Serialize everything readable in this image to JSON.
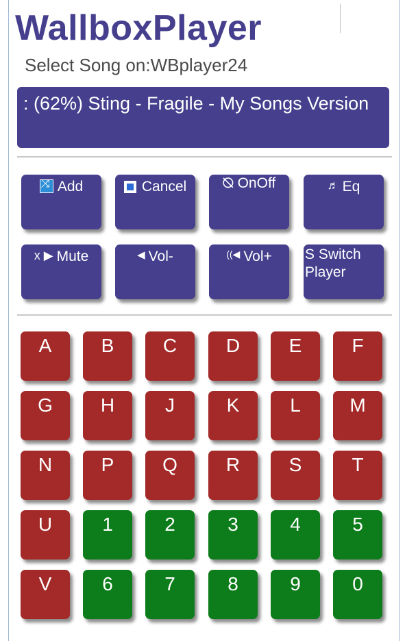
{
  "app": {
    "title": "WallboxPlayer",
    "subtitle": "Select Song on:WBplayer24"
  },
  "now_playing": {
    "text": ": (62%) Sting - Fragile - My Songs Version"
  },
  "controls": [
    {
      "label": "Add",
      "icon": "shuffle-icon",
      "glyph": "⤨"
    },
    {
      "label": "Cancel",
      "icon": "stop-icon",
      "glyph": ""
    },
    {
      "label": "OnOff",
      "icon": "power-icon",
      "glyph": "⦰"
    },
    {
      "label": "Eq",
      "icon": "music-note-icon",
      "glyph": "♬"
    },
    {
      "label": "Mute",
      "icon": "mute-icon",
      "glyph": "x ▶"
    },
    {
      "label": "Vol-",
      "icon": "speaker-low-icon",
      "glyph": "◀"
    },
    {
      "label": "Vol+",
      "icon": "speaker-high-icon",
      "glyph": "((◀"
    },
    {
      "label": "S Switch Player",
      "icon": "",
      "glyph": ""
    }
  ],
  "keys": {
    "row1": [
      "A",
      "B",
      "C",
      "D",
      "E",
      "F"
    ],
    "row2": [
      "G",
      "H",
      "J",
      "K",
      "L",
      "M"
    ],
    "row3": [
      "N",
      "P",
      "Q",
      "R",
      "S",
      "T"
    ],
    "row4": [
      "U",
      "1",
      "2",
      "3",
      "4",
      "5"
    ],
    "row5": [
      "V",
      "6",
      "7",
      "8",
      "9",
      "0"
    ]
  },
  "colors": {
    "brand": "#453f8d",
    "letter_key": "#a32a28",
    "digit_key": "#0d7c1a"
  }
}
